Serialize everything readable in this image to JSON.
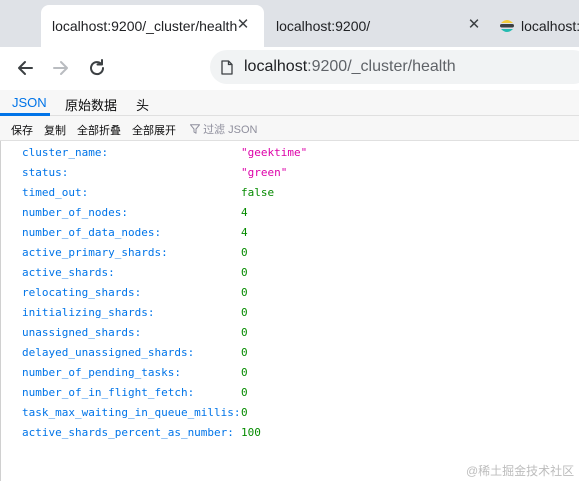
{
  "browser": {
    "tabs": [
      {
        "title": "localhost:9200/_cluster/health",
        "active": true
      },
      {
        "title": "localhost:9200/",
        "active": false
      },
      {
        "title": "localhost:",
        "active": false,
        "icon": "elastic-icon"
      }
    ],
    "address": {
      "host": "localhost",
      "path": ":9200/_cluster/health"
    }
  },
  "viewer": {
    "tabs": [
      "JSON",
      "原始数据",
      "头"
    ],
    "actions": [
      "保存",
      "复制",
      "全部折叠",
      "全部展开"
    ],
    "filter_placeholder": "过滤 JSON"
  },
  "json": [
    {
      "key": "cluster_name:",
      "value": "\"geektime\"",
      "type": "string"
    },
    {
      "key": "status:",
      "value": "\"green\"",
      "type": "string"
    },
    {
      "key": "timed_out:",
      "value": "false",
      "type": "boolean"
    },
    {
      "key": "number_of_nodes:",
      "value": "4",
      "type": "number"
    },
    {
      "key": "number_of_data_nodes:",
      "value": "4",
      "type": "number"
    },
    {
      "key": "active_primary_shards:",
      "value": "0",
      "type": "number"
    },
    {
      "key": "active_shards:",
      "value": "0",
      "type": "number"
    },
    {
      "key": "relocating_shards:",
      "value": "0",
      "type": "number"
    },
    {
      "key": "initializing_shards:",
      "value": "0",
      "type": "number"
    },
    {
      "key": "unassigned_shards:",
      "value": "0",
      "type": "number"
    },
    {
      "key": "delayed_unassigned_shards:",
      "value": "0",
      "type": "number"
    },
    {
      "key": "number_of_pending_tasks:",
      "value": "0",
      "type": "number"
    },
    {
      "key": "number_of_in_flight_fetch:",
      "value": "0",
      "type": "number"
    },
    {
      "key": "task_max_waiting_in_queue_millis:",
      "value": "0",
      "type": "number"
    },
    {
      "key": "active_shards_percent_as_number:",
      "value": "100",
      "type": "number"
    }
  ],
  "watermark": "@稀土掘金技术社区",
  "colors": {
    "key": "#0074e8",
    "string": "#dd00a9",
    "number": "#058b00",
    "accent": "#0074e8"
  }
}
